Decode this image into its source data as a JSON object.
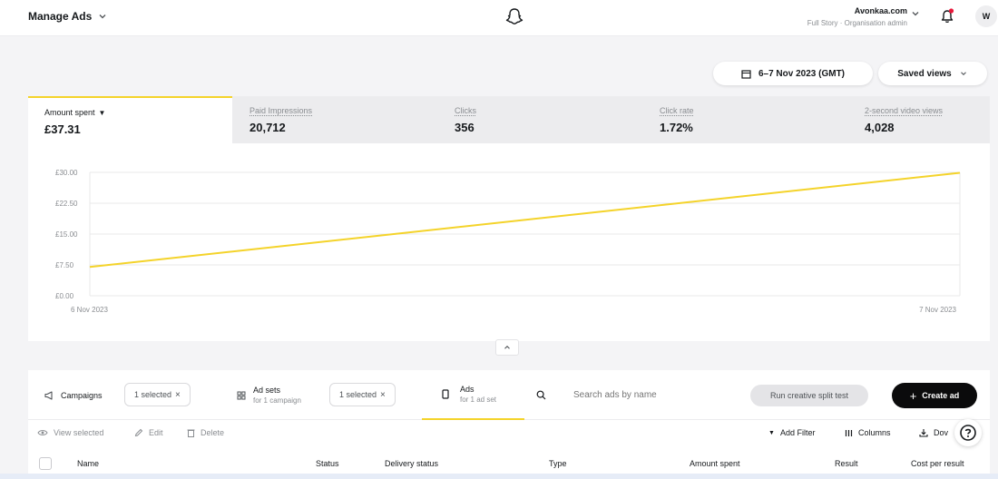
{
  "header": {
    "title": "Manage Ads",
    "org_name": "Avonkaa.com",
    "org_role": "Full Story · Organisation admin",
    "avatar_initial": "W"
  },
  "date_range": {
    "label": "6–7 Nov 2023 (GMT)"
  },
  "saved_views": {
    "label": "Saved views"
  },
  "metrics": [
    {
      "label": "Amount spent",
      "value": "£37.31",
      "active": true
    },
    {
      "label": "Paid Impressions",
      "value": "20,712"
    },
    {
      "label": "Clicks",
      "value": "356"
    },
    {
      "label": "Click rate",
      "value": "1.72%"
    },
    {
      "label": "2-second video views",
      "value": "4,028"
    }
  ],
  "chart_data": {
    "type": "line",
    "x": [
      "6 Nov 2023",
      "7 Nov 2023"
    ],
    "series": [
      {
        "values": [
          7.0,
          29.9
        ],
        "color": "#f4d32a"
      }
    ],
    "ylim": [
      0,
      30
    ],
    "yticks": [
      "£0.00",
      "£7.50",
      "£15.00",
      "£22.50",
      "£30.00"
    ],
    "xticks": [
      "6 Nov 2023",
      "7 Nov 2023"
    ],
    "grid": true
  },
  "tabs": {
    "campaigns": {
      "label": "Campaigns",
      "chip": "1 selected"
    },
    "adsets": {
      "label": "Ad sets",
      "sub": "for 1 campaign",
      "chip": "1 selected"
    },
    "ads": {
      "label": "Ads",
      "sub": "for 1 ad set"
    }
  },
  "search": {
    "placeholder": "Search ads by name"
  },
  "buttons": {
    "split_test": "Run creative split test",
    "create_ad": "Create ad"
  },
  "actions": {
    "view_selected": "View selected",
    "edit": "Edit",
    "delete": "Delete",
    "add_filter": "Add Filter",
    "columns": "Columns",
    "download": "Dov"
  },
  "table": {
    "columns": [
      "Name",
      "Status",
      "Delivery status",
      "Type",
      "Amount spent",
      "Result",
      "Cost per result"
    ]
  }
}
